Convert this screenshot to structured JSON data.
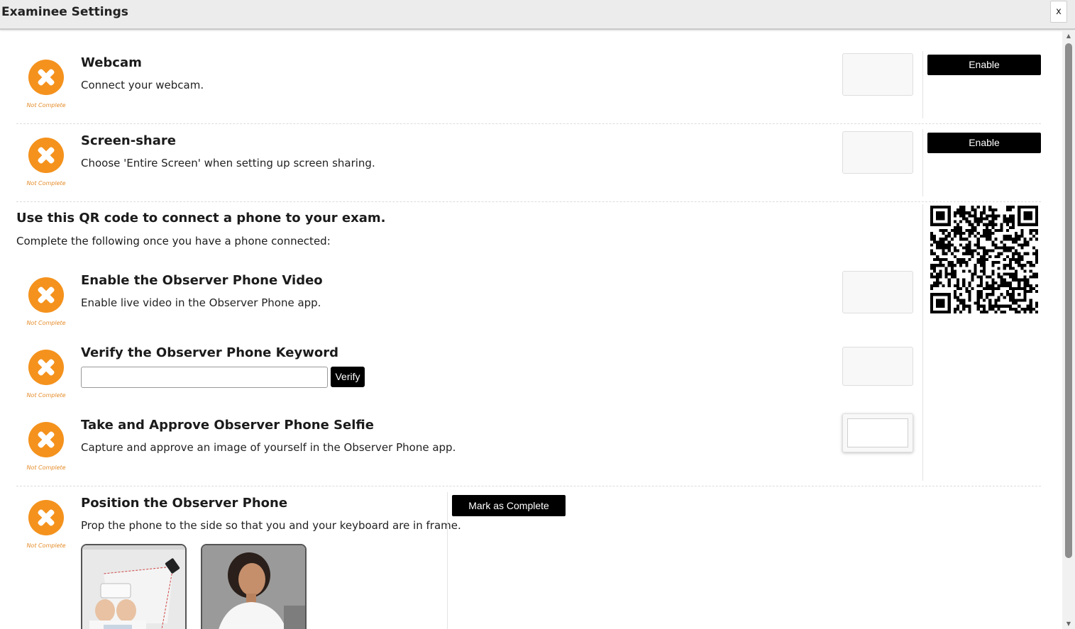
{
  "window": {
    "title": "Examinee Settings",
    "close_label": "x"
  },
  "items": {
    "webcam": {
      "title": "Webcam",
      "description": "Connect your webcam.",
      "status": "Not Complete",
      "button": "Enable"
    },
    "screenshare": {
      "title": "Screen-share",
      "description": "Choose 'Entire Screen' when setting up screen sharing.",
      "status": "Not Complete",
      "button": "Enable"
    },
    "phone_video": {
      "title": "Enable the Observer Phone Video",
      "description": "Enable live video in the Observer Phone app.",
      "status": "Not Complete"
    },
    "phone_keyword": {
      "title": "Verify the Observer Phone Keyword",
      "input_value": "",
      "status": "Not Complete",
      "button": "Verify"
    },
    "phone_selfie": {
      "title": "Take and Approve Observer Phone Selfie",
      "description": "Capture and approve an image of yourself in the Observer Phone app.",
      "status": "Not Complete"
    },
    "phone_position": {
      "title": "Position the Observer Phone",
      "description": "Prop the phone to the side so that you and your keyboard are in frame.",
      "status": "Not Complete",
      "button": "Mark as Complete"
    }
  },
  "qr_section": {
    "heading": "Use this QR code to connect a phone to your exam.",
    "subheading": "Complete the following once you have a phone connected:"
  },
  "colors": {
    "status_orange": "#f4921d",
    "button_black": "#000000",
    "not_complete_text": "#e58c2a"
  },
  "icons": {
    "status": "x-circle-icon",
    "qr": "qr-code-icon"
  }
}
